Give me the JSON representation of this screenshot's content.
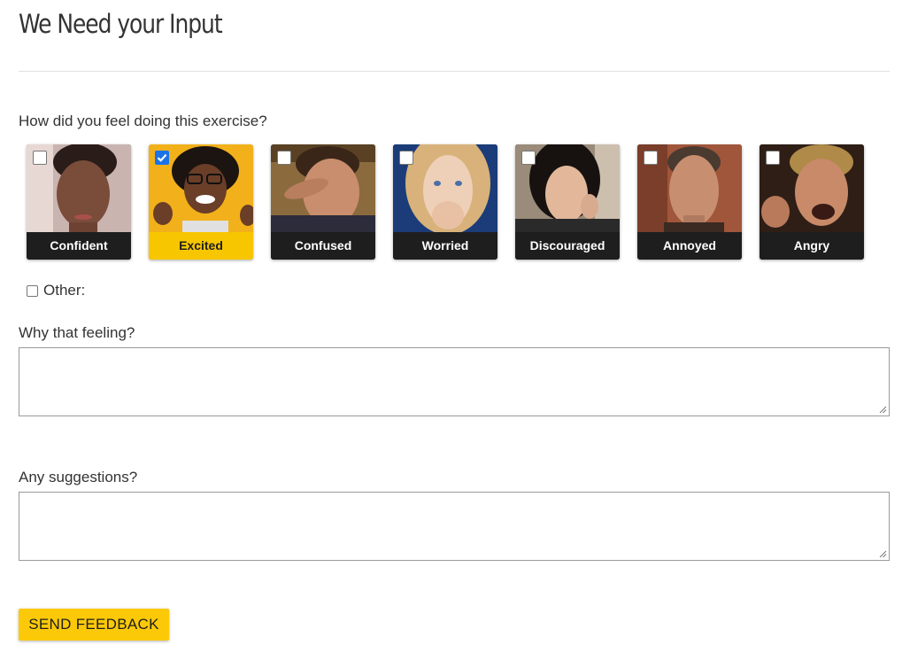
{
  "page": {
    "title": "We Need your Input"
  },
  "questions": {
    "feel": "How did you feel doing this exercise?",
    "why": "Why that feeling?",
    "suggestions": "Any suggestions?"
  },
  "emotions": [
    {
      "label": "Confident",
      "checked": false
    },
    {
      "label": "Excited",
      "checked": true
    },
    {
      "label": "Confused",
      "checked": false
    },
    {
      "label": "Worried",
      "checked": false
    },
    {
      "label": "Discouraged",
      "checked": false
    },
    {
      "label": "Annoyed",
      "checked": false
    },
    {
      "label": "Angry",
      "checked": false
    }
  ],
  "other": {
    "label": "Other:",
    "checked": false
  },
  "fields": {
    "why_value": "",
    "suggestions_value": ""
  },
  "actions": {
    "send_label": "SEND FEEDBACK"
  },
  "colors": {
    "accent": "#fcc908",
    "caption_bg": "#1e1e1e",
    "checkbox_checked": "#1a73e8"
  },
  "icons": {
    "checkbox": "checkbox-icon",
    "checkmark": "checkmark-icon",
    "resize": "resize-grip-icon"
  }
}
